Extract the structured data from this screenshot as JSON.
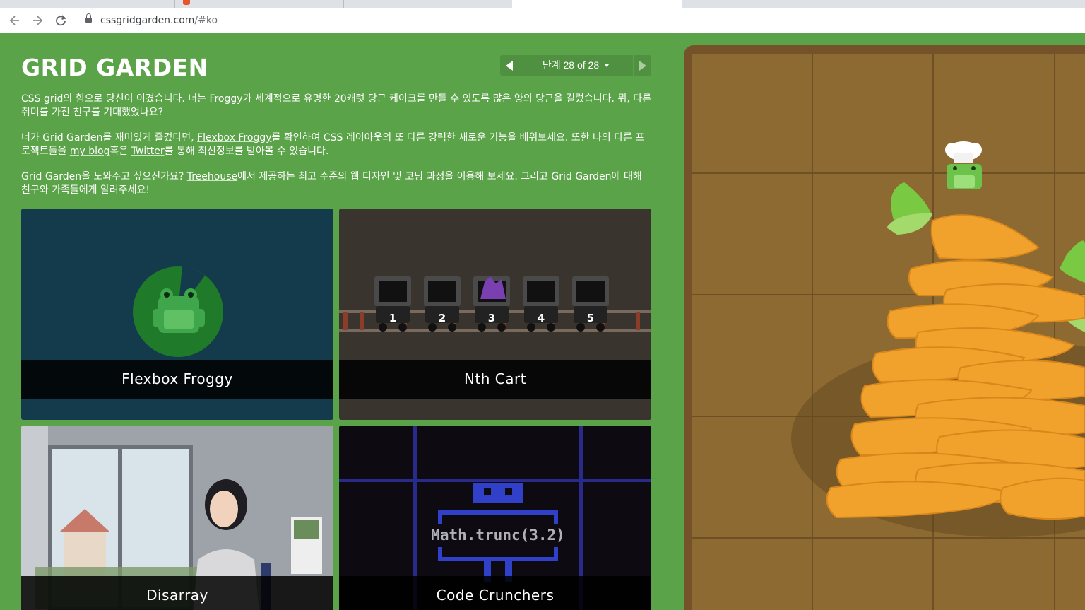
{
  "browser": {
    "url_host": "cssgridgarden.com",
    "url_path": "/#ko"
  },
  "game": {
    "title": "GRID GARDEN",
    "level_label": "단계 28 of 28"
  },
  "intro": {
    "p1": "CSS grid의 힘으로 당신이 이겼습니다. 너는 Froggy가 세계적으로 유명한 20캐럿 당근 케이크를 만들 수 있도록 많은 양의 당근을 길렀습니다. 뭐, 다른 취미를 가진 친구를 기대했었나요?",
    "p2_a": "너가 Grid Garden를 재미있게 즐겼다면, ",
    "p2_link1": "Flexbox Froggy",
    "p2_b": "를 확인하여 CSS 레이아웃의 또 다른 강력한 새로운 기능을 배워보세요. 또한 나의 다른 프로젝트들을 ",
    "p2_link2": "my blog",
    "p2_c": "혹은 ",
    "p2_link3": "Twitter",
    "p2_d": "를 통해 최신정보를 받아볼 수 있습니다.",
    "p3_a": "Grid Garden을 도와주고 싶으신가요? ",
    "p3_link": "Treehouse",
    "p3_b": "에서 제공하는 최고 수준의 웹 디자인 및 코딩 과정을 이용해 보세요. 그리고 Grid Garden에 대해 친구와 가족들에게 알려주세요!"
  },
  "cards": [
    {
      "label": "Flexbox Froggy"
    },
    {
      "label": "Nth Cart",
      "cart_numbers": [
        "1",
        "2",
        "3",
        "4",
        "5"
      ]
    },
    {
      "label": "Disarray"
    },
    {
      "label": "Code Crunchers",
      "code": "Math.trunc(3.2)"
    }
  ],
  "colors": {
    "page_green": "#5ba348",
    "froggy_bg": "#143b4b",
    "nthcart_bg": "#3a342f",
    "crunchers_bg": "#0d0a12",
    "carrot": "#f0a22c",
    "soil": "#8c6a31"
  }
}
